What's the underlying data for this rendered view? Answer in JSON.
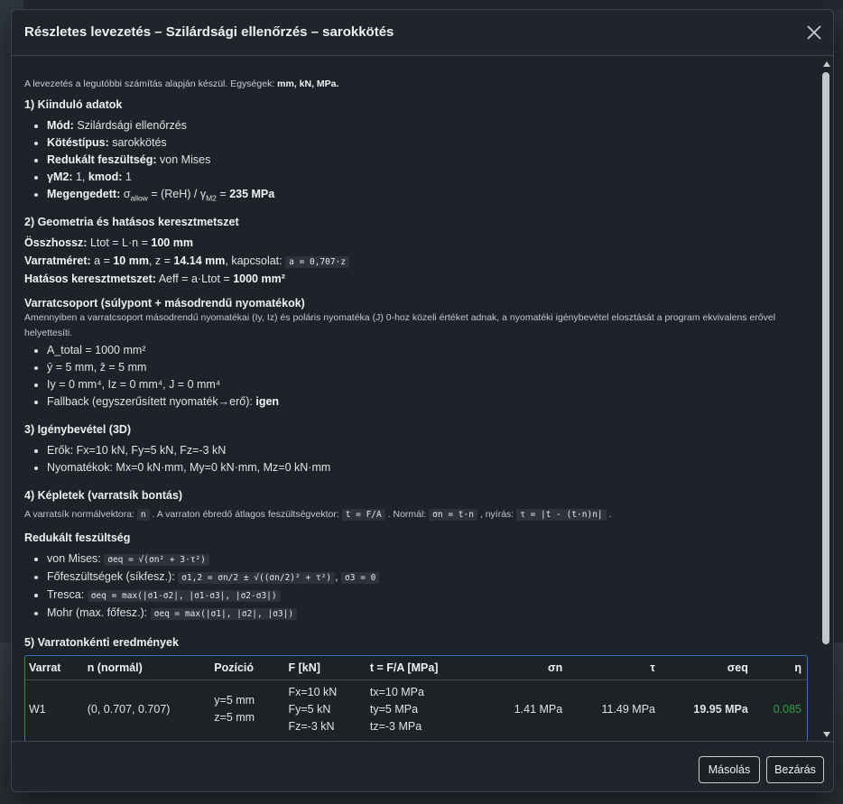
{
  "modal": {
    "title": "Részletes levezetés – Szilárdsági ellenőrzés – sarokkötés"
  },
  "intro": {
    "text": "A levezetés a legutóbbi számítás alapján készül. Egységek:",
    "units": "mm, kN, MPa."
  },
  "s1": {
    "title": "1) Kiinduló adatok",
    "items": [
      {
        "label": "Mód:",
        "value": "Szilárdsági ellenőrzés"
      },
      {
        "label": "Kötéstípus:",
        "value": "sarokkötés"
      },
      {
        "label": "Redukált feszültség:",
        "value": "von Mises"
      }
    ],
    "gamma": {
      "label1": "γM2:",
      "value1": "1,",
      "label2": "kmod:",
      "value2": "1"
    },
    "allow": {
      "label": "Megengedett:",
      "sigma": "σ",
      "sub1": "allow",
      "mid": "= (ReH) / γ",
      "sub2": "M2",
      "eq": "=",
      "value": "235 MPa"
    }
  },
  "s2": {
    "title": "2) Geometria és hatásos keresztmetszet",
    "total": {
      "label": "Összhossz:",
      "text": "Ltot = L·n =",
      "value": "100 mm"
    },
    "weld": {
      "label": "Varratméret:",
      "t1": "a =",
      "v1": "10 mm",
      "t2": ", z =",
      "v2": "14.14 mm",
      "t3": ", kapcsolat:",
      "code": "a = 0,707·z"
    },
    "area": {
      "label": "Hatásos keresztmetszet:",
      "text": "Aeff = a·Ltot =",
      "value": "1000 mm²"
    }
  },
  "group": {
    "title": "Varratcsoport (súlypont + másodrendű nyomatékok)",
    "note": "Amennyiben a varratcsoport másodrendű nyomatékai (Iy, Iz) és poláris nyomatéka (J) 0-hoz közeli értéket adnak, a nyomatéki igénybevétel elosztását a program ekvivalens erővel helyettesíti.",
    "items": [
      "A_total = 1000 mm²",
      "ȳ = 5 mm, z̄ = 5 mm",
      "Iy = 0 mm⁴, Iz = 0 mm⁴, J = 0 mm⁴"
    ],
    "fallback_label": "Fallback (egyszerűsített nyomaték→erő):",
    "fallback_value": "igen"
  },
  "s3": {
    "title": "3) Igénybevétel (3D)",
    "items": [
      "Erők: Fx=10 kN, Fy=5 kN, Fz=-3 kN",
      "Nyomatékok: Mx=0 kN·mm, My=0 kN·mm, Mz=0 kN·mm"
    ]
  },
  "s4": {
    "title": "4) Képletek (varratsík bontás)",
    "t1": "A varratsík normálvektora:",
    "c1": "n",
    "t2": ". A varraton ébredő átlagos feszültségvektor:",
    "c2": "t = F/A",
    "t3": ". Normál:",
    "c3": "σn = t·n",
    "t4": ", nyírás:",
    "c4": "τ = |t - (t·n)n|",
    "t5": "."
  },
  "reduced": {
    "title": "Redukált feszültség",
    "vm_label": "von Mises:",
    "vm_code": "σeq = √(σn² + 3·τ²)",
    "pr_label": "Főfeszültségek (síkfesz.):",
    "pr_code1": "σ1,2 = σn/2 ± √((σn/2)² + τ²)",
    "pr_sep": ",",
    "pr_code2": "σ3 = 0",
    "tr_label": "Tresca:",
    "tr_code": "σeq = max(|σ1-σ2|, |σ1-σ3|, |σ2-σ3|)",
    "mo_label": "Mohr (max. főfesz.):",
    "mo_code": "σeq = max(|σ1|, |σ2|, |σ3|)"
  },
  "s5": {
    "title": "5) Varratonkénti eredmények",
    "headers": [
      "Varrat",
      "n (normál)",
      "Pozíció",
      "F [kN]",
      "t = F/A [MPa]",
      "σn",
      "τ",
      "σeq",
      "η"
    ],
    "row": {
      "weld": "W1",
      "n": "(0, 0.707, 0.707)",
      "pos": [
        "y=5 mm",
        "z=5 mm"
      ],
      "f": [
        "Fx=10 kN",
        "Fy=5 kN",
        "Fz=-3 kN"
      ],
      "t": [
        "tx=10 MPa",
        "ty=5 MPa",
        "tz=-3 MPa"
      ],
      "sn": "1.41 MPa",
      "tau": "11.49 MPa",
      "seq": "19.95 MPa",
      "eta": "0.085"
    }
  },
  "footer": {
    "copy": "Másolás",
    "close": "Bezárás"
  },
  "colors": {
    "accent": "#2e76c2",
    "ok": "#2fa043",
    "modal_bg": "#1e2329"
  }
}
